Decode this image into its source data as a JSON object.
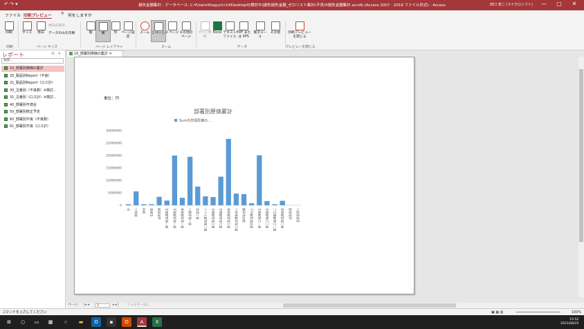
{
  "titlebar": {
    "title": "損失金額集計 : データベース- C:¥Users¥Itaguchi-k¥Desktop¥[検討中]損失損失金額_ゼロリスト集計(不良)¥損失金額集計.accdb (Access 2007 - 2016 ファイル形式) - Access",
    "user": "田口 浩二 (マイクロソフト)",
    "qat": "↶ ↷ ▾",
    "min": "—",
    "max": "▢",
    "close": "✕"
  },
  "tabs": {
    "file": "ファイル",
    "preview": "印刷プレビュー",
    "tell": "何をしますか"
  },
  "ribbon": {
    "print": "印刷",
    "size": "サイズ",
    "margin": "余白",
    "only_data": "データのみを印刷",
    "show_margin": "余白の表示",
    "portrait": "縦",
    "landscape": "横",
    "columns": "列",
    "page_setup": "ページ設定",
    "zoom": "ズーム",
    "one_page": "1 ページ",
    "two_page": "2 ページ",
    "other_pages": "その他のページ",
    "refresh": "すべて更新",
    "excel": "Excel",
    "textfile": "テキストファイル",
    "pdf": "PDF または XPS",
    "email": "電子メール",
    "more": "その他",
    "close_preview": "印刷プレビューを閉じる",
    "groups": {
      "print": "印刷",
      "page_size": "ページ サイズ",
      "page_layout": "ページ レイアウト",
      "zoom": "ズーム",
      "data": "データ",
      "close": "プレビューを閉じる"
    }
  },
  "nav": {
    "title": "レポート",
    "search": "検索...",
    "items": [
      "10_部署別損価の集計",
      "20_製品別Report（不良）",
      "21_製品別Report（ロス計）",
      "30_注番別（不良数）※検討...",
      "31_注番別（ロス計）※検討...",
      "40_部署別不適合",
      "50_部署別修正予定",
      "60_部署別不良（不良数）",
      "61_部署別不良（ロス計）"
    ]
  },
  "doctab": "10_部署別損価の集計",
  "report": {
    "unit": "単位：円"
  },
  "chart_data": {
    "type": "bar",
    "title": "部署別原価累計",
    "legend": [
      "Sumの年間原価の..."
    ],
    "ylim": [
      0,
      30000000
    ],
    "yticks": [
      "30000000",
      "25000000",
      "20000000",
      "15000000",
      "10000000",
      "5000000",
      "0"
    ],
    "categories": [
      "外",
      "開発二",
      "資材",
      "生産管",
      "品質管理",
      "第一製造課組立",
      "第一製造課組立",
      "第一製造課塗装",
      "第一製造課二",
      "第二製造",
      "第二製造課ライン",
      "第三製造課組立",
      "第三製造課組立",
      "第三製造課塗装",
      "第三製造課塗装二",
      "第四製造課",
      "第四製造課仕上",
      "第一工程課組立",
      "第二工程課組立",
      "第二工程課組立二",
      "第二製造課塗装",
      "品質管理",
      "品質管理二"
    ],
    "values": [
      400000,
      5600000,
      400000,
      400000,
      3400000,
      1900000,
      20000000,
      3000000,
      19500000,
      7500000,
      3600000,
      3300000,
      11500000,
      26700000,
      4700000,
      4500000,
      800000,
      20100000,
      1700000,
      400000,
      1800000,
      0,
      0
    ],
    "grid": false
  },
  "recnav": {
    "label": "ページ:",
    "page": "1",
    "filter": "フィルターなし"
  },
  "status": {
    "left": "コマンドを入力してください",
    "zoom": "100%"
  },
  "taskbar": {
    "time": "15:52",
    "date": "2021/08/25"
  }
}
